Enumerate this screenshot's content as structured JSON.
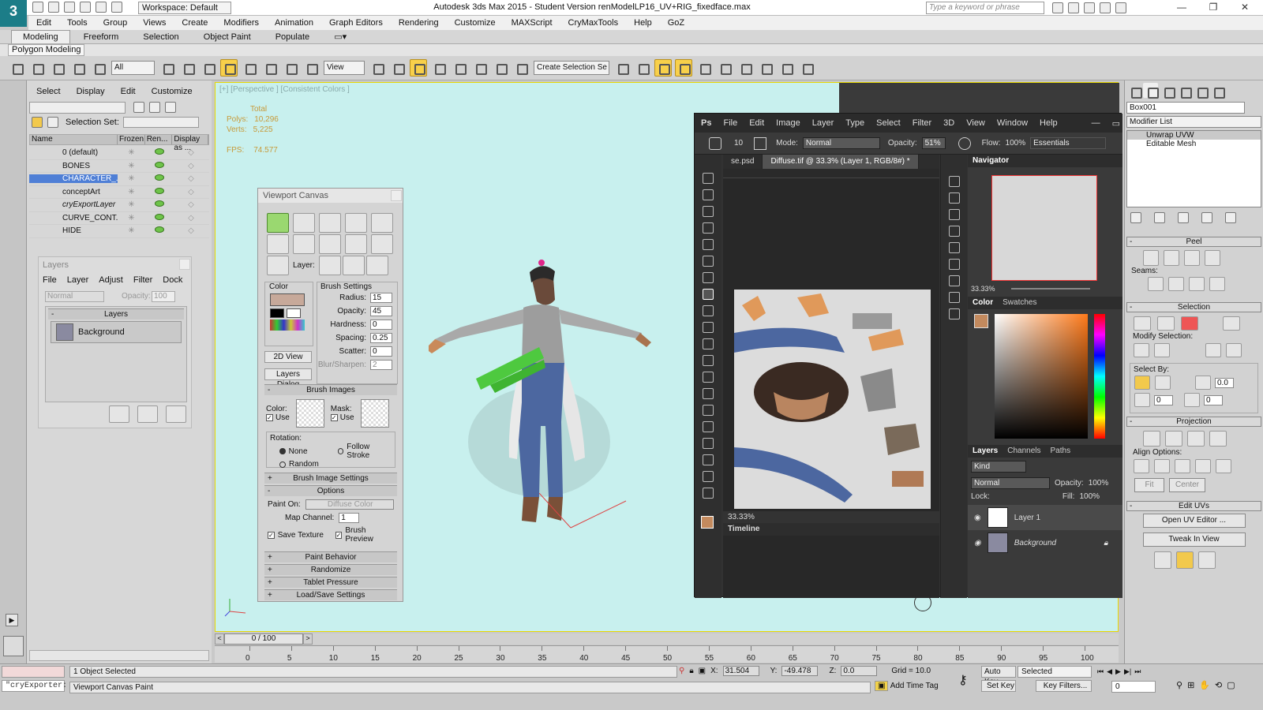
{
  "title": {
    "app_title": "Autodesk 3ds Max 2015  -  Student Version   renModelLP16_UV+RIG_fixedface.max",
    "workspace": "Workspace: Default",
    "search_placeholder": "Type a keyword or phrase"
  },
  "menubar": [
    "Edit",
    "Tools",
    "Group",
    "Views",
    "Create",
    "Modifiers",
    "Animation",
    "Graph Editors",
    "Rendering",
    "Customize",
    "MAXScript",
    "CryMaxTools",
    "Help",
    "GoZ"
  ],
  "ribbon": {
    "tabs": [
      "Modeling",
      "Freeform",
      "Selection",
      "Object Paint",
      "Populate"
    ],
    "sub": "Polygon Modeling"
  },
  "toolbar": {
    "filter": "All",
    "ref_coord": "View",
    "selection_set": "Create Selection Se"
  },
  "explorer": {
    "menu": [
      "Select",
      "Display",
      "Edit",
      "Customize"
    ],
    "selection_set_label": "Selection Set:",
    "columns": [
      "Name",
      "Frozen",
      "Ren...",
      "Display as ..."
    ],
    "rows": [
      {
        "name": "0 (default)"
      },
      {
        "name": "BONES"
      },
      {
        "name": "CHARACTER_..."
      },
      {
        "name": "conceptArt"
      },
      {
        "name": "cryExportLayer"
      },
      {
        "name": "CURVE_CONT..."
      },
      {
        "name": "HIDE"
      }
    ]
  },
  "layers_panel": {
    "title": "Layers",
    "menu": [
      "File",
      "Layer",
      "Adjust",
      "Filter",
      "Dock"
    ],
    "mode": "Normal",
    "opacity_label": "Opacity:",
    "opacity": "100",
    "section": "Layers",
    "layer": "Background"
  },
  "viewport": {
    "label": "[+] [Perspective ] [Consistent Colors ]",
    "stats_total": "Total",
    "polys_label": "Polys:",
    "polys": "10,296",
    "verts_label": "Verts:",
    "verts": "5,225",
    "fps_label": "FPS:",
    "fps": "74.577"
  },
  "viewport_canvas": {
    "title": "Viewport Canvas",
    "layer_label": "Layer:",
    "color_label": "Color",
    "brush_settings": "Brush Settings",
    "radius_label": "Radius:",
    "radius": "15",
    "opacity_label": "Opacity:",
    "opacity": "45",
    "hardness_label": "Hardness:",
    "hardness": "0",
    "spacing_label": "Spacing:",
    "spacing": "0.25",
    "scatter_label": "Scatter:",
    "scatter": "0",
    "blur_label": "Blur/Sharpen:",
    "blur": "2",
    "btn_2d": "2D View",
    "btn_layers": "Layers Dialog",
    "brush_images": "Brush Images",
    "color_img_label": "Color:",
    "mask_img_label": "Mask:",
    "use_label": "Use",
    "rotation_label": "Rotation:",
    "rot_none": "None",
    "rot_follow": "Follow Stroke",
    "rot_random": "Random",
    "brush_image_settings": "Brush Image Settings",
    "options": "Options",
    "paint_on_label": "Paint On:",
    "paint_on": "Diffuse Color",
    "map_channel_label": "Map Channel:",
    "map_channel": "1",
    "save_texture": "Save Texture",
    "brush_preview": "Brush Preview",
    "rollouts": [
      "Paint Behavior",
      "Randomize",
      "Tablet Pressure",
      "Load/Save Settings"
    ]
  },
  "photoshop": {
    "logo": "Ps",
    "menu": [
      "File",
      "Edit",
      "Image",
      "Layer",
      "Type",
      "Select",
      "Filter",
      "3D",
      "View",
      "Window",
      "Help"
    ],
    "brush_size": "10",
    "mode_label": "Mode:",
    "mode": "Normal",
    "opacity_label": "Opacity:",
    "opacity": "51%",
    "flow_label": "Flow:",
    "flow": "100%",
    "preset": "Essentials",
    "tab1": "se.psd",
    "tab2": "Diffuse.tif @ 33.3% (Layer 1, RGB/8#) *",
    "zoom": "33.33%",
    "timeline": "Timeline",
    "navigator": "Navigator",
    "nav_zoom": "33.33%",
    "color_tab": "Color",
    "swatches_tab": "Swatches",
    "layers_tab": "Layers",
    "channels_tab": "Channels",
    "paths_tab": "Paths",
    "kind": "Kind",
    "blend": "Normal",
    "layer_opacity_label": "Opacity:",
    "layer_opacity": "100%",
    "lock_label": "Lock:",
    "fill_label": "Fill:",
    "fill": "100%",
    "layers": [
      "Layer 1",
      "Background"
    ]
  },
  "command_panel": {
    "object_name": "Box001",
    "modifier_list": "Modifier List",
    "stack": [
      "Unwrap UVW",
      "Editable Mesh"
    ],
    "peel": "Peel",
    "seams": "Seams:",
    "selection": "Selection",
    "modify_selection": "Modify Selection:",
    "select_by": "Select By:",
    "select_by_val1": "0.0",
    "select_by_val2": "0",
    "select_by_val3": "0",
    "projection": "Projection",
    "align_options": "Align Options:",
    "fit": "Fit",
    "center": "Center",
    "edit_uvs": "Edit UVs",
    "open_uv_editor": "Open UV Editor ...",
    "tweak_in_view": "Tweak In View"
  },
  "timeline": {
    "frame": "0 / 100",
    "ticks": [
      "0",
      "5",
      "10",
      "15",
      "20",
      "25",
      "30",
      "35",
      "40",
      "45",
      "50",
      "55",
      "60",
      "65",
      "70",
      "75",
      "80",
      "85",
      "90",
      "95",
      "100"
    ]
  },
  "status": {
    "maxscript": "\"cryExporter:",
    "selected": "1 Object Selected",
    "prompt": "Viewport Canvas Paint",
    "x_label": "X:",
    "x": "31.504",
    "y_label": "Y:",
    "y": "-49.478",
    "z_label": "Z:",
    "z": "0.0",
    "grid": "Grid = 10.0",
    "add_time_tag": "Add Time Tag",
    "auto_key": "Auto Key",
    "set_key": "Set Key",
    "key_mode": "Selected",
    "key_filters": "Key Filters...",
    "frame_field": "0"
  }
}
